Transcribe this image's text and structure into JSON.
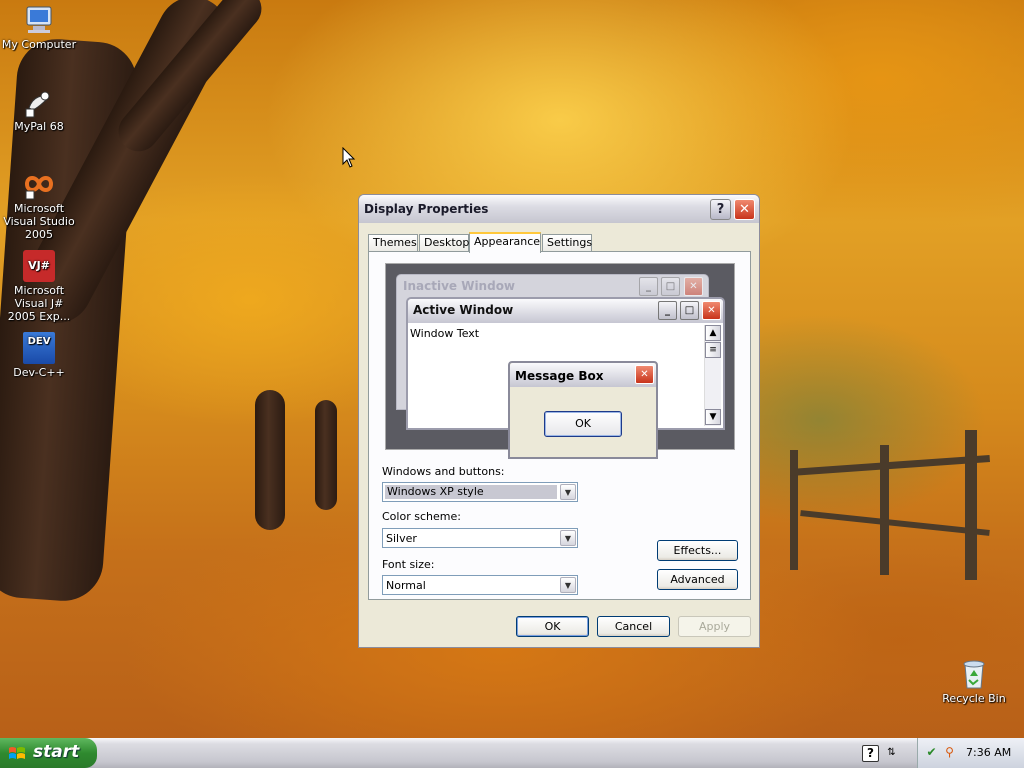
{
  "desktop": {
    "icons": [
      {
        "label": "My Computer",
        "icon": "my-computer-icon"
      },
      {
        "label": "MyPal 68",
        "icon": "mypal-icon"
      },
      {
        "label": "Microsoft Visual Studio 2005",
        "icon": "visual-studio-icon"
      },
      {
        "label": "Microsoft Visual J# 2005 Exp...",
        "icon": "visual-jsharp-icon"
      },
      {
        "label": "Dev-C++",
        "icon": "devcpp-icon"
      },
      {
        "label": "Recycle Bin",
        "icon": "recycle-bin-icon"
      }
    ],
    "dev_badge": "DEV",
    "vj_badge": "VJ#"
  },
  "dialog": {
    "title": "Display Properties",
    "help_glyph": "?",
    "close_glyph": "✕",
    "tabs": [
      {
        "label": "Themes",
        "active": false
      },
      {
        "label": "Desktop",
        "active": false
      },
      {
        "label": "Appearance",
        "active": true
      },
      {
        "label": "Settings",
        "active": false
      }
    ],
    "preview": {
      "inactive_title": "Inactive Window",
      "active_title": "Active Window",
      "window_text": "Window Text",
      "message_box_title": "Message Box",
      "message_box_ok": "OK"
    },
    "windows_and_buttons": {
      "label": "Windows and buttons:",
      "value": "Windows XP style"
    },
    "color_scheme": {
      "label": "Color scheme:",
      "value": "Silver"
    },
    "font_size": {
      "label": "Font size:",
      "value": "Normal"
    },
    "effects_button": "Effects...",
    "advanced_button": "Advanced",
    "ok_button": "OK",
    "cancel_button": "Cancel",
    "apply_button": "Apply"
  },
  "taskbar": {
    "start_label": "start",
    "clock": "7:36 AM",
    "tray_icons": [
      "help-icon",
      "network-icon",
      "security-icon",
      "search-icon"
    ]
  },
  "colors": {
    "start_green": "#3c9a3c",
    "dialog_face": "#ece9d8",
    "active_tab_accent": "#ffc83c",
    "close_red": "#c8341c"
  }
}
